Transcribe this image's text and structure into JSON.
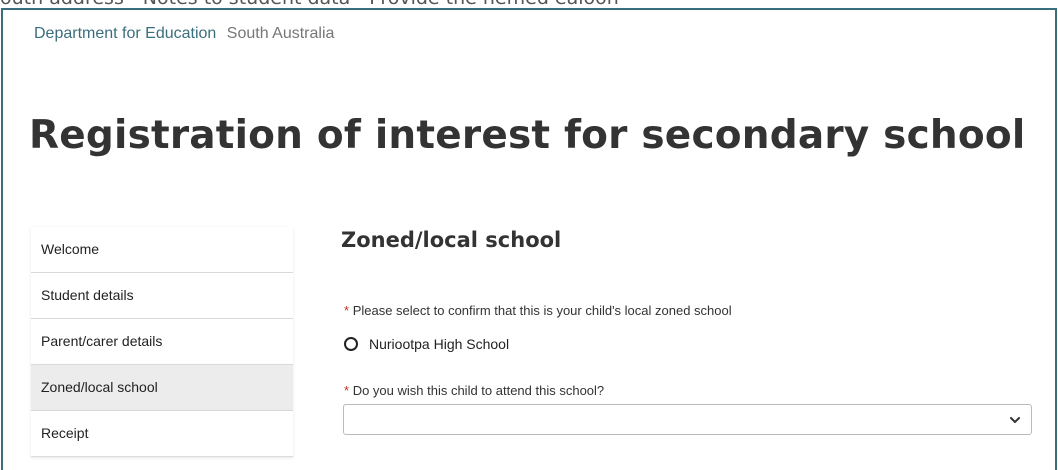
{
  "clipped_top_text": "outh address - Notes to student data - Provide the nemed ealoon",
  "header": {
    "department": "Department for Education",
    "state": "South Australia"
  },
  "page_title": "Registration of interest for secondary school",
  "sidebar": {
    "items": [
      {
        "label": "Welcome",
        "active": false
      },
      {
        "label": "Student details",
        "active": false
      },
      {
        "label": "Parent/carer details",
        "active": false
      },
      {
        "label": "Zoned/local school",
        "active": true
      },
      {
        "label": "Receipt",
        "active": false
      }
    ]
  },
  "main": {
    "section_title": "Zoned/local school",
    "required_marker": "*",
    "question_confirm": "Please select to confirm that this is your child's local zoned school",
    "school_option": "Nuriootpa High School",
    "question_attend": "Do you wish this child to attend this school?",
    "attend_select_value": ""
  },
  "icons": {
    "radio": "radio-unchecked-icon",
    "select_arrow": "chevron-down-icon"
  },
  "colors": {
    "brand": "#3b6e7c",
    "required": "#c0392b",
    "active_nav_bg": "#ececec"
  }
}
